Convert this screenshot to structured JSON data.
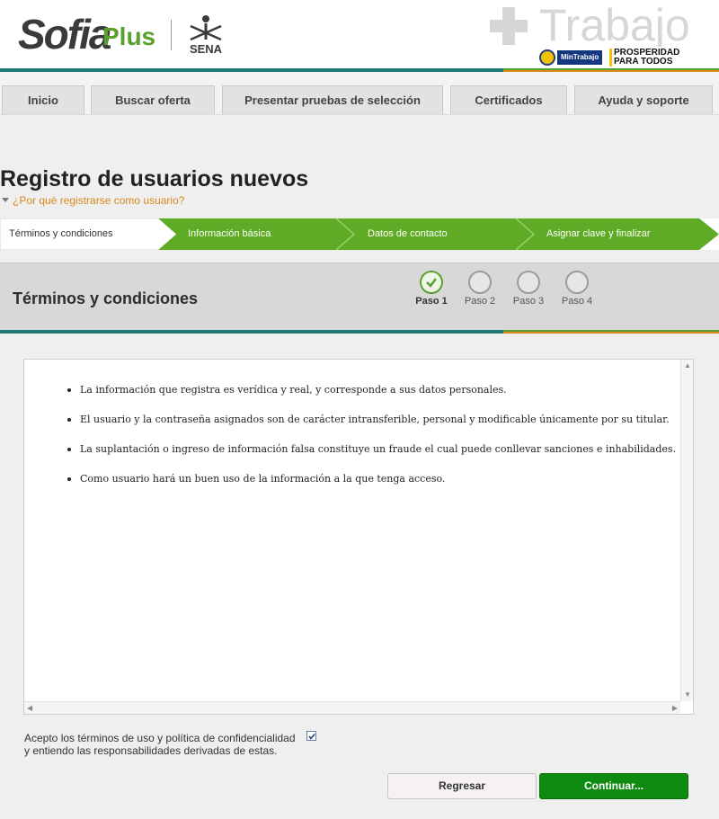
{
  "header": {
    "logo_sofia": "Sofia",
    "logo_plus": "Plus",
    "logo_sena": "SENA",
    "trabajo": "Trabajo",
    "mintrabajo": "MinTrabajo",
    "prosperidad": "PROSPERIDAD PARA TODOS"
  },
  "nav": {
    "items": [
      {
        "label": "Inicio"
      },
      {
        "label": "Buscar oferta"
      },
      {
        "label": "Presentar pruebas de selección"
      },
      {
        "label": "Certificados"
      },
      {
        "label": "Ayuda y soporte"
      }
    ]
  },
  "page": {
    "title": "Registro de usuarios nuevos",
    "why_link": "¿Por qué registrarse como usuario?"
  },
  "wizard": {
    "steps": [
      {
        "label": "Términos y condiciones"
      },
      {
        "label": "Información básica"
      },
      {
        "label": "Datos de contacto"
      },
      {
        "label": "Asignar clave y finalizar"
      }
    ]
  },
  "section": {
    "title": "Términos y condiciones",
    "steps": [
      {
        "label": "Paso 1",
        "done": true
      },
      {
        "label": "Paso 2",
        "done": false
      },
      {
        "label": "Paso 3",
        "done": false
      },
      {
        "label": "Paso 4",
        "done": false
      }
    ]
  },
  "terms": {
    "items": [
      "La información que registra es verídica y real, y corresponde a sus datos personales.",
      "El usuario y la contraseña asignados son de carácter intransferible, personal y modificable únicamente por su titular.",
      "La suplantación o ingreso de información falsa constituye un fraude el cual puede conllevar sanciones e inhabilidades.",
      "Como usuario hará un buen uso de la información a la que tenga acceso."
    ]
  },
  "consent": {
    "line1": "Acepto los términos de uso y política de confidencialidad",
    "line2": "y entiendo las responsabilidades derivadas de estas.",
    "checked": true
  },
  "buttons": {
    "back": "Regresar",
    "next": "Continuar..."
  },
  "colors": {
    "accent_green": "#5aa02c",
    "teal": "#1d7a76",
    "orange": "#d9891a",
    "continue_button": "#0f8a10"
  }
}
